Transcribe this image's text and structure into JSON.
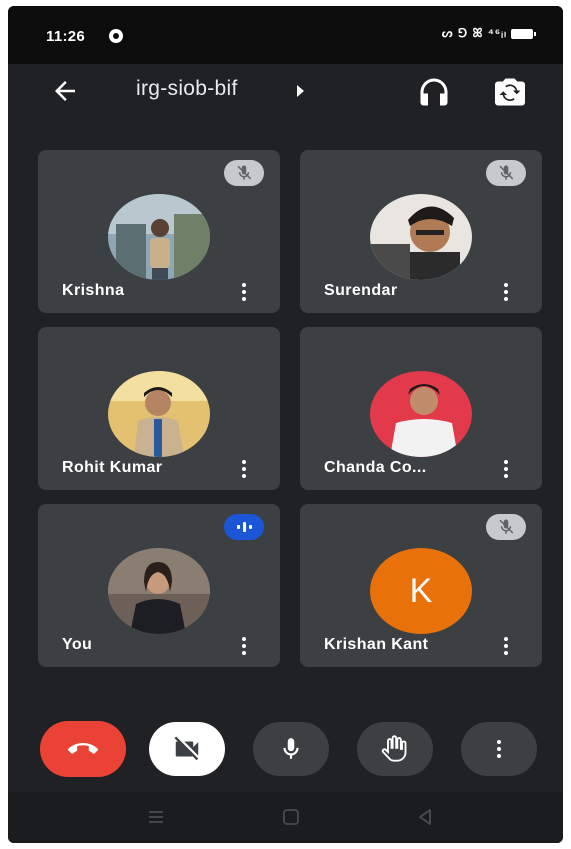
{
  "status_bar": {
    "time": "11:26",
    "icons_text": "ᔕ ⅁ ꕤ ⁴⁶ᵢₗ"
  },
  "app_bar": {
    "meeting_code": "irg-siob-bif"
  },
  "participants": [
    {
      "name": "Krishna",
      "muted": true,
      "avatar": "photo"
    },
    {
      "name": "Surendar",
      "muted": true,
      "avatar": "photo"
    },
    {
      "name": "Rohit Kumar",
      "muted": false,
      "avatar": "photo"
    },
    {
      "name": "Chanda Co...",
      "muted": false,
      "avatar": "photo"
    },
    {
      "name": "You",
      "speaking": true,
      "avatar": "photo"
    },
    {
      "name": "Krishan Kant",
      "muted": true,
      "avatar": "letter",
      "initial": "K",
      "avatar_color": "#e8710a"
    }
  ],
  "controls": [
    {
      "name": "end-call",
      "color": "#ea4335"
    },
    {
      "name": "camera-off",
      "color": "#ffffff"
    },
    {
      "name": "microphone",
      "color": "#3c4043"
    },
    {
      "name": "raise-hand",
      "color": "#3c4043"
    },
    {
      "name": "more-options",
      "color": "#3c4043"
    }
  ],
  "colors": {
    "background": "#202124",
    "tile": "#3c4043",
    "accent_blue": "#1a56d6",
    "end_call_red": "#ea4335"
  }
}
